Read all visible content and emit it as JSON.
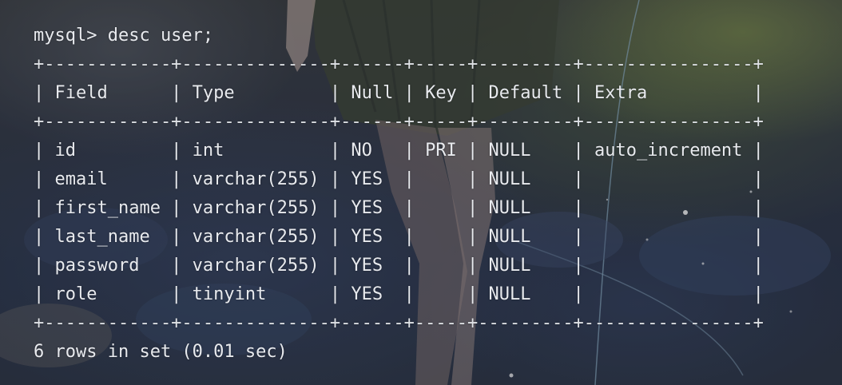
{
  "terminal": {
    "prompt_line": "mysql> desc user;",
    "separator": "+------------+--------------+------+-----+---------+----------------+",
    "header": "| Field      | Type         | Null | Key | Default | Extra          |",
    "rows": [
      "| id         | int          | NO   | PRI | NULL    | auto_increment |",
      "| email      | varchar(255) | YES  |     | NULL    |                |",
      "| first_name | varchar(255) | YES  |     | NULL    |                |",
      "| last_name  | varchar(255) | YES  |     | NULL    |                |",
      "| password   | varchar(255) | YES  |     | NULL    |                |",
      "| role       | tinyint      | YES  |     | NULL    |                |"
    ],
    "summary": "6 rows in set (0.01 sec)"
  },
  "colors": {
    "text": "#e8eaee",
    "background": "#2b3140"
  }
}
